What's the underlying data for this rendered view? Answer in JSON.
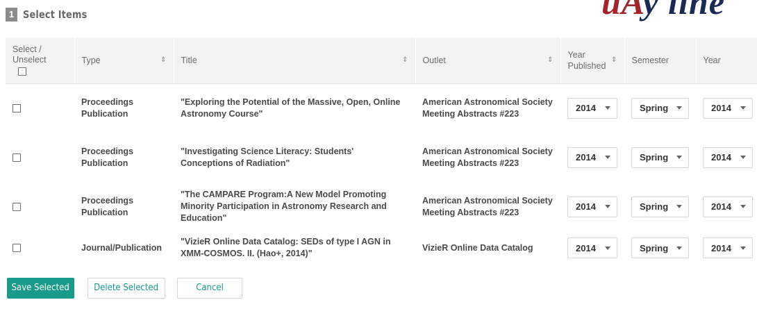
{
  "step": {
    "number": "1",
    "title": "Select Items"
  },
  "brand": {
    "logo_text_1": "uA",
    "logo_text_2": "y line"
  },
  "table": {
    "headers": {
      "select": "Select / Unselect",
      "type": "Type",
      "title": "Title",
      "outlet": "Outlet",
      "year_published": "Year Published",
      "semester": "Semester",
      "year": "Year"
    },
    "rows": [
      {
        "type": "Proceedings Publication",
        "title": "\"Exploring the Potential of the Massive, Open, Online Astronomy Course\"",
        "outlet": "American Astronomical Society Meeting Abstracts #223",
        "year_published": "2014",
        "semester": "Spring",
        "year": "2014"
      },
      {
        "type": "Proceedings Publication",
        "title": "\"Investigating Science Literacy: Students' Conceptions of Radiation\"",
        "outlet": "American Astronomical Society Meeting Abstracts #223",
        "year_published": "2014",
        "semester": "Spring",
        "year": "2014"
      },
      {
        "type": "Proceedings Publication",
        "title": "\"The CAMPARE Program:A New Model Promoting Minority Participation in Astronomy Research and Education\"",
        "outlet": "American Astronomical Society Meeting Abstracts #223",
        "year_published": "2014",
        "semester": "Spring",
        "year": "2014"
      },
      {
        "type": "Journal/Publication",
        "title": "\"VizieR Online Data Catalog: SEDs of type I AGN in XMM-COSMOS. II. (Hao+, 2014)\"",
        "outlet": "VizieR Online Data Catalog",
        "year_published": "2014",
        "semester": "Spring",
        "year": "2014"
      }
    ]
  },
  "buttons": {
    "save": "Save Selected",
    "delete": "Delete Selected",
    "cancel": "Cancel"
  },
  "colors": {
    "accent": "#1a9b8a",
    "header_bg": "#f3f3f3",
    "logo_red": "#a5232b",
    "logo_navy": "#1b2a55"
  },
  "icons": {
    "sort": "sort-updown-icon",
    "dropdown": "chevron-down-icon",
    "checkbox": "checkbox-unchecked"
  }
}
